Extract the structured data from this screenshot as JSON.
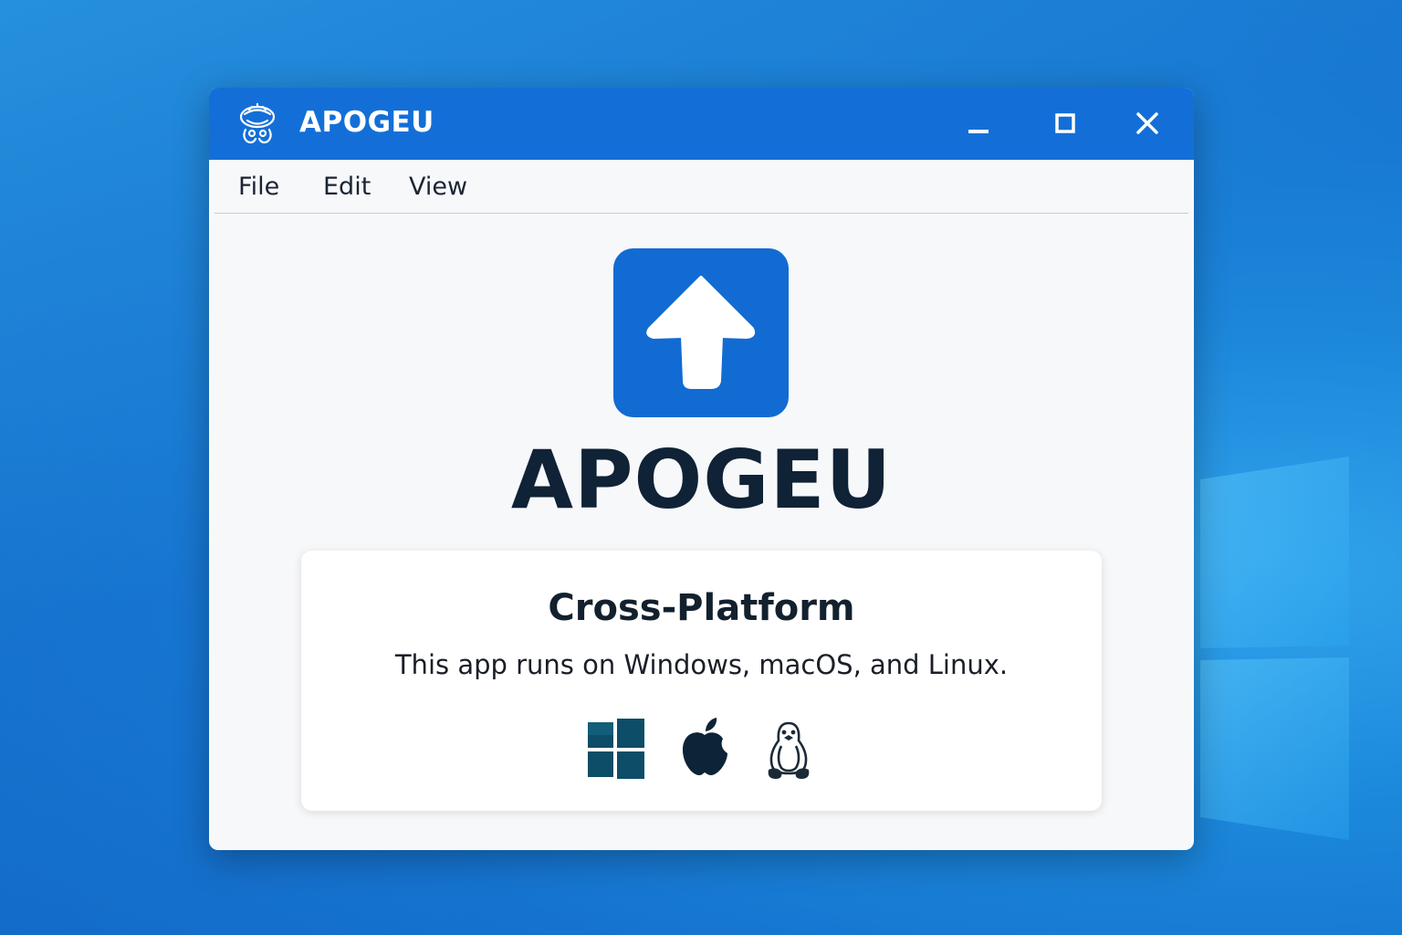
{
  "window": {
    "title": "APOGEU",
    "title_icon": "app-mascot-icon",
    "controls": {
      "minimize_icon": "minimize-icon",
      "maximize_icon": "maximize-icon",
      "close_icon": "close-icon"
    }
  },
  "menu": {
    "items": [
      {
        "label": "File"
      },
      {
        "label": "Edit"
      },
      {
        "label": "View"
      }
    ]
  },
  "main": {
    "app_icon": "arrow-up-icon",
    "app_name": "APOGEU",
    "card": {
      "title": "Cross-Platform",
      "description": "This app runs on Windows, macOS, and Linux.",
      "platform_icons": [
        "windows-icon",
        "apple-icon",
        "linux-icon"
      ]
    }
  },
  "colors": {
    "accent": "#136fd7",
    "app_icon_bg": "#126bd2",
    "text_dark": "#0f2236",
    "window_bg": "#f7f8fa"
  }
}
